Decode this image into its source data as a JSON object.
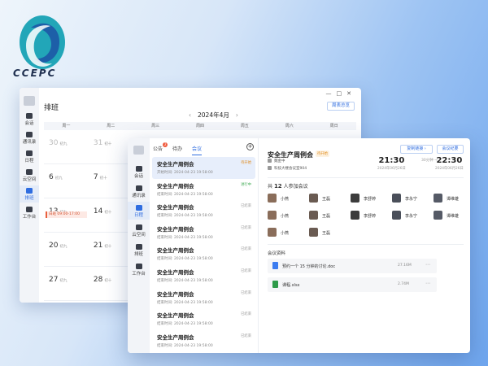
{
  "brand": {
    "logo_text": "CCEPC"
  },
  "back_window": {
    "avatar": "头像",
    "title": "排班",
    "controls": [
      "—",
      "□",
      "✕"
    ],
    "top_button": "周表总览",
    "month": "2024年4月",
    "nav": [
      {
        "label": "会话",
        "icon": "chat-icon"
      },
      {
        "label": "通讯录",
        "icon": "contacts-icon"
      },
      {
        "label": "日程",
        "icon": "calendar-icon"
      },
      {
        "label": "云空间",
        "icon": "cloud-icon"
      },
      {
        "label": "排班",
        "icon": "schedule-icon",
        "active": true
      },
      {
        "label": "工作台",
        "icon": "grid-icon"
      }
    ],
    "weekdays": [
      "周一",
      "周二",
      "周三",
      "周四",
      "周五",
      "周六",
      "周日"
    ],
    "rows": [
      [
        {
          "d": "30",
          "s": "初九"
        },
        {
          "d": "31",
          "s": "初十"
        }
      ],
      [
        {
          "d": "6",
          "s": "初九"
        },
        {
          "d": "7",
          "s": "初十"
        }
      ],
      [
        {
          "d": "13",
          "s": "初九",
          "event": "白班 09:00-17:00"
        },
        {
          "d": "14",
          "s": "初十"
        }
      ],
      [
        {
          "d": "20",
          "s": "初九"
        },
        {
          "d": "21",
          "s": "初十"
        }
      ],
      [
        {
          "d": "27",
          "s": "初九"
        },
        {
          "d": "28",
          "s": "初十"
        }
      ]
    ]
  },
  "front_window": {
    "avatar": "头像",
    "nav": [
      {
        "label": "会话",
        "icon": "chat-icon"
      },
      {
        "label": "通讯录",
        "icon": "contacts-icon"
      },
      {
        "label": "日程",
        "icon": "calendar-icon",
        "active": true
      },
      {
        "label": "云空间",
        "icon": "cloud-icon"
      },
      {
        "label": "排班",
        "icon": "schedule-icon"
      },
      {
        "label": "工作台",
        "icon": "grid-icon"
      }
    ],
    "tabs": [
      {
        "label": "公告",
        "badge": "2"
      },
      {
        "label": "待办"
      },
      {
        "label": "会议",
        "active": true
      }
    ],
    "meetings": [
      {
        "title": "安全生产周例会",
        "time": "开始时间: 2024-04-23 19:58:00",
        "status": "待开始",
        "color": "#e08a1a",
        "selected": true
      },
      {
        "title": "安全生产周例会",
        "time": "结束时间: 2024-04-23 19:58:00",
        "status": "进行中",
        "color": "#3aa84f"
      },
      {
        "title": "安全生产周例会",
        "time": "结束时间: 2024-04-23 19:58:00",
        "status": "已结束",
        "color": "#999999"
      },
      {
        "title": "安全生产周例会",
        "time": "结束时间: 2024-04-23 19:58:00",
        "status": "已结束",
        "color": "#999999"
      },
      {
        "title": "安全生产周例会",
        "time": "结束时间: 2024-04-23 19:58:00",
        "status": "已结束",
        "color": "#999999"
      },
      {
        "title": "安全生产周例会",
        "time": "结束时间: 2024-04-23 19:58:00",
        "status": "已结束",
        "color": "#999999"
      },
      {
        "title": "安全生产周例会",
        "time": "结束时间: 2024-04-23 19:58:00",
        "status": "已结束",
        "color": "#999999"
      },
      {
        "title": "安全生产周例会",
        "time": "结束时间: 2024-04-23 19:58:00",
        "status": "已结束",
        "color": "#999999"
      },
      {
        "title": "安全生产周例会",
        "time": "结束时间: 2024-04-23 19:58:00",
        "status": "已结束",
        "color": "#999999"
      }
    ],
    "detail": {
      "title": "安全生产周例会",
      "tag": "待开始",
      "btn_copy": "复制链接 ›",
      "btn_summary": "会议纪要",
      "host": "魏金中",
      "room": "科技大楼会议室904",
      "start_time": "21:30",
      "start_date": "2024年06月26日",
      "duration": "30分钟",
      "end_time": "22:30",
      "end_date": "2024年06月26日",
      "count_prefix": "共",
      "count": "12",
      "count_suffix": "人参加会议",
      "people": [
        "小燕",
        "王磊",
        "李舒婷",
        "李永宁",
        "谭维雄",
        "小燕",
        "王磊",
        "李舒婷",
        "李永宁",
        "谭维雄",
        "小燕",
        "王磊"
      ],
      "materials_label": "会议资料",
      "files": [
        {
          "name": "预约一个 15 分钟的讨论.doc",
          "size": "27.16M",
          "icon": "doc-icon",
          "color": "#3b7cf0"
        },
        {
          "name": "课程.xlsx",
          "size": "2.74M",
          "icon": "xlsx-icon",
          "color": "#2e9b4a"
        }
      ]
    }
  }
}
